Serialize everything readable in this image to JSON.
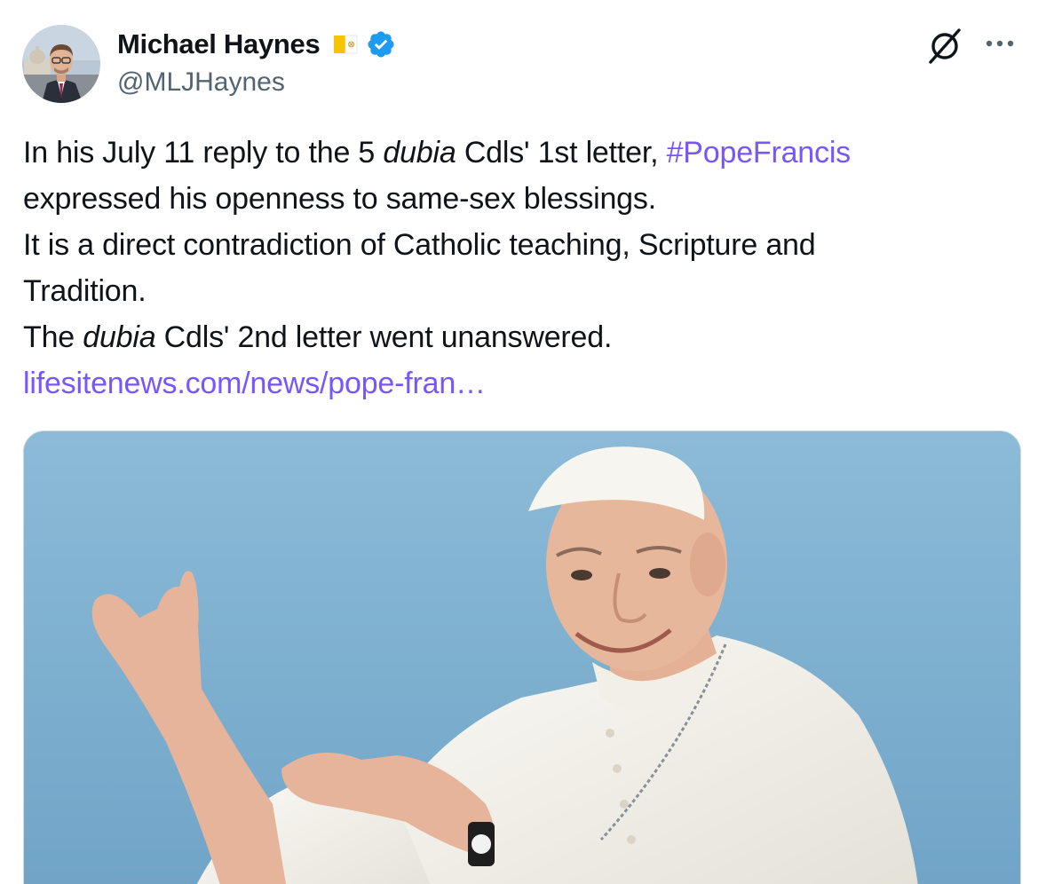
{
  "author": {
    "display_name": "Michael Haynes",
    "handle": "@MLJHaynes",
    "flag_icon": "vatican-flag-icon",
    "verified_icon": "verified-badge-icon",
    "verified_color": "#1d9bf0"
  },
  "actions": {
    "grok_icon": "grok-icon",
    "more_icon": "more-options-icon"
  },
  "tweet": {
    "line1_pre": "In his July 11 reply to the 5 ",
    "line1_em": "dubia",
    "line1_post": " Cdls' 1st letter, ",
    "hashtag": "#PopeFrancis",
    "line2": "expressed his openness to same-sex blessings.",
    "line3": "It is a direct contradiction of Catholic teaching, Scripture and",
    "line4": "Tradition.",
    "line5_pre": "The ",
    "line5_em": "dubia",
    "line5_post": " Cdls' 2nd letter went unanswered.",
    "link": "lifesitenews.com/news/pope-fran…"
  },
  "colors": {
    "text": "#0f1419",
    "secondary": "#536471",
    "accent_link": "#7856ff",
    "sky": "#7eaecd"
  }
}
